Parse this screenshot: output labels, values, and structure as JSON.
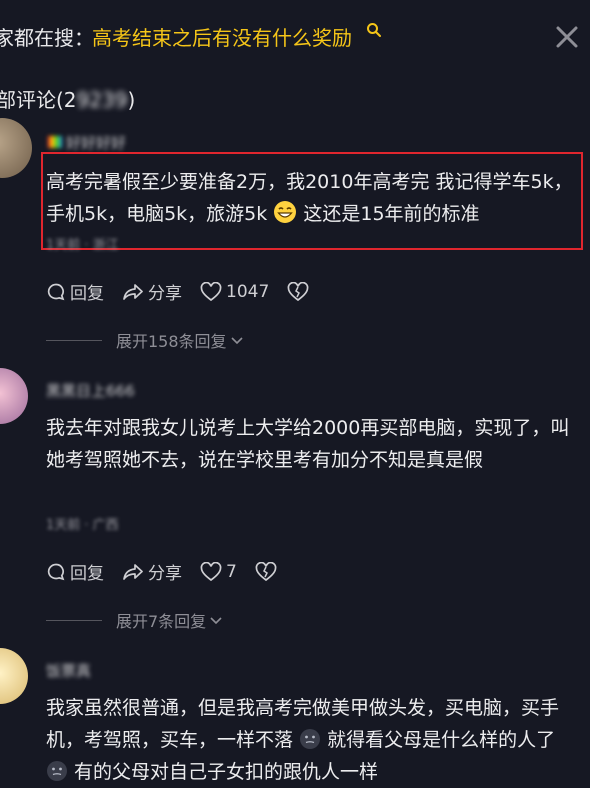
{
  "search_bar": {
    "prefix": "家都在搜：",
    "query": "高考结束之后有没有什么奖励"
  },
  "header": {
    "title_prefix": "部评论(2",
    "title_count_obscured": "9239",
    "title_suffix": ")"
  },
  "comments": [
    {
      "username": "好好好好",
      "text_part1": "高考完暑假至少要准备2万，我2010年高考完 我记得学车5k，手机5k，电脑5k，旅游5k",
      "text_part2": "这还是15年前的标准",
      "meta": "1天前 · 浙江",
      "reply_label": "回复",
      "share_label": "分享",
      "likes": "1047",
      "expand_label": "展开158条回复"
    },
    {
      "username": "黑黑日上666",
      "text": "我去年对跟我女儿说考上大学给2000再买部电脑，实现了，叫她考驾照她不去，说在学校里考有加分不知是真是假",
      "meta": "1天前 · 广西",
      "reply_label": "回复",
      "share_label": "分享",
      "likes": "7",
      "expand_label": "展开7条回复"
    },
    {
      "username": "饭票真",
      "text_part1": "我家虽然很普通，但是我高考完做美甲做头发，买电脑，买手机，考驾照，买车，一样不落",
      "text_part2": "就得看父母是什么样的人了",
      "text_part3": "有的父母对自己子女扣的跟仇人一样"
    }
  ],
  "colors": {
    "background": "#161823",
    "accent_yellow": "#f5c518",
    "highlight_red": "#e0262e"
  }
}
